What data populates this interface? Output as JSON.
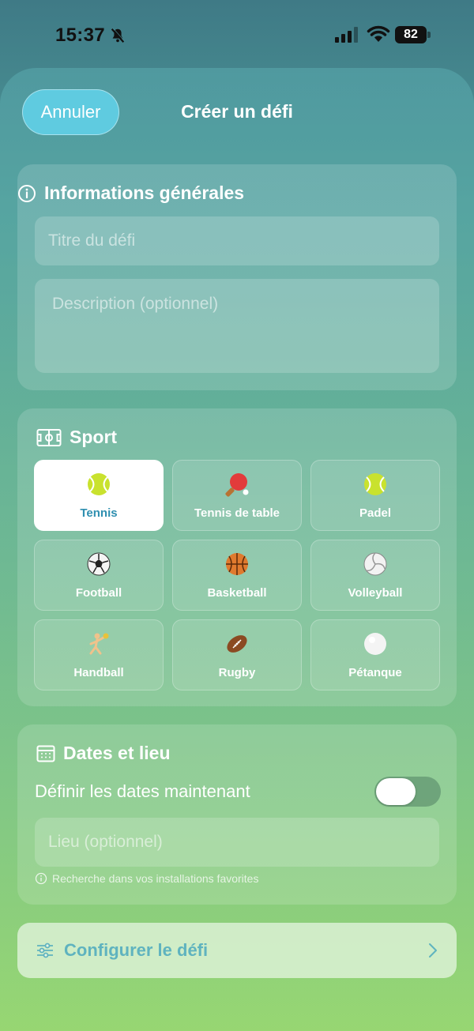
{
  "status_bar": {
    "time": "15:37",
    "battery": "82",
    "icons": [
      "bell-off-icon",
      "signal-icon",
      "wifi-icon",
      "battery-icon"
    ]
  },
  "header": {
    "cancel_label": "Annuler",
    "title": "Créer un défi"
  },
  "general_info": {
    "title": "Informations générales",
    "icon": "info-icon",
    "title_placeholder": "Titre du défi",
    "description_placeholder": "Description (optionnel)"
  },
  "sport": {
    "title": "Sport",
    "icon": "field-icon",
    "selected": "Tennis",
    "items": [
      {
        "label": "Tennis",
        "emoji": "🎾"
      },
      {
        "label": "Tennis de table",
        "emoji": "🏓"
      },
      {
        "label": "Padel",
        "emoji": "🎾"
      },
      {
        "label": "Football",
        "emoji": "⚽"
      },
      {
        "label": "Basketball",
        "emoji": "🏀"
      },
      {
        "label": "Volleyball",
        "emoji": "🏐"
      },
      {
        "label": "Handball",
        "emoji": "🤾"
      },
      {
        "label": "Rugby",
        "emoji": "🏉"
      },
      {
        "label": "Pétanque",
        "emoji": "⚪"
      }
    ]
  },
  "dates": {
    "title": "Dates et lieu",
    "icon": "calendar-icon",
    "toggle_label": "Définir les dates maintenant",
    "toggle_on": false,
    "location_placeholder": "Lieu (optionnel)",
    "hint": "Recherche dans vos installations favorites"
  },
  "footer": {
    "configure_label": "Configurer le défi",
    "icon": "sliders-icon"
  },
  "colors": {
    "accent": "#5fcbe0",
    "selected_text": "#2f8fb0",
    "configure_text": "#5fb3bf"
  }
}
